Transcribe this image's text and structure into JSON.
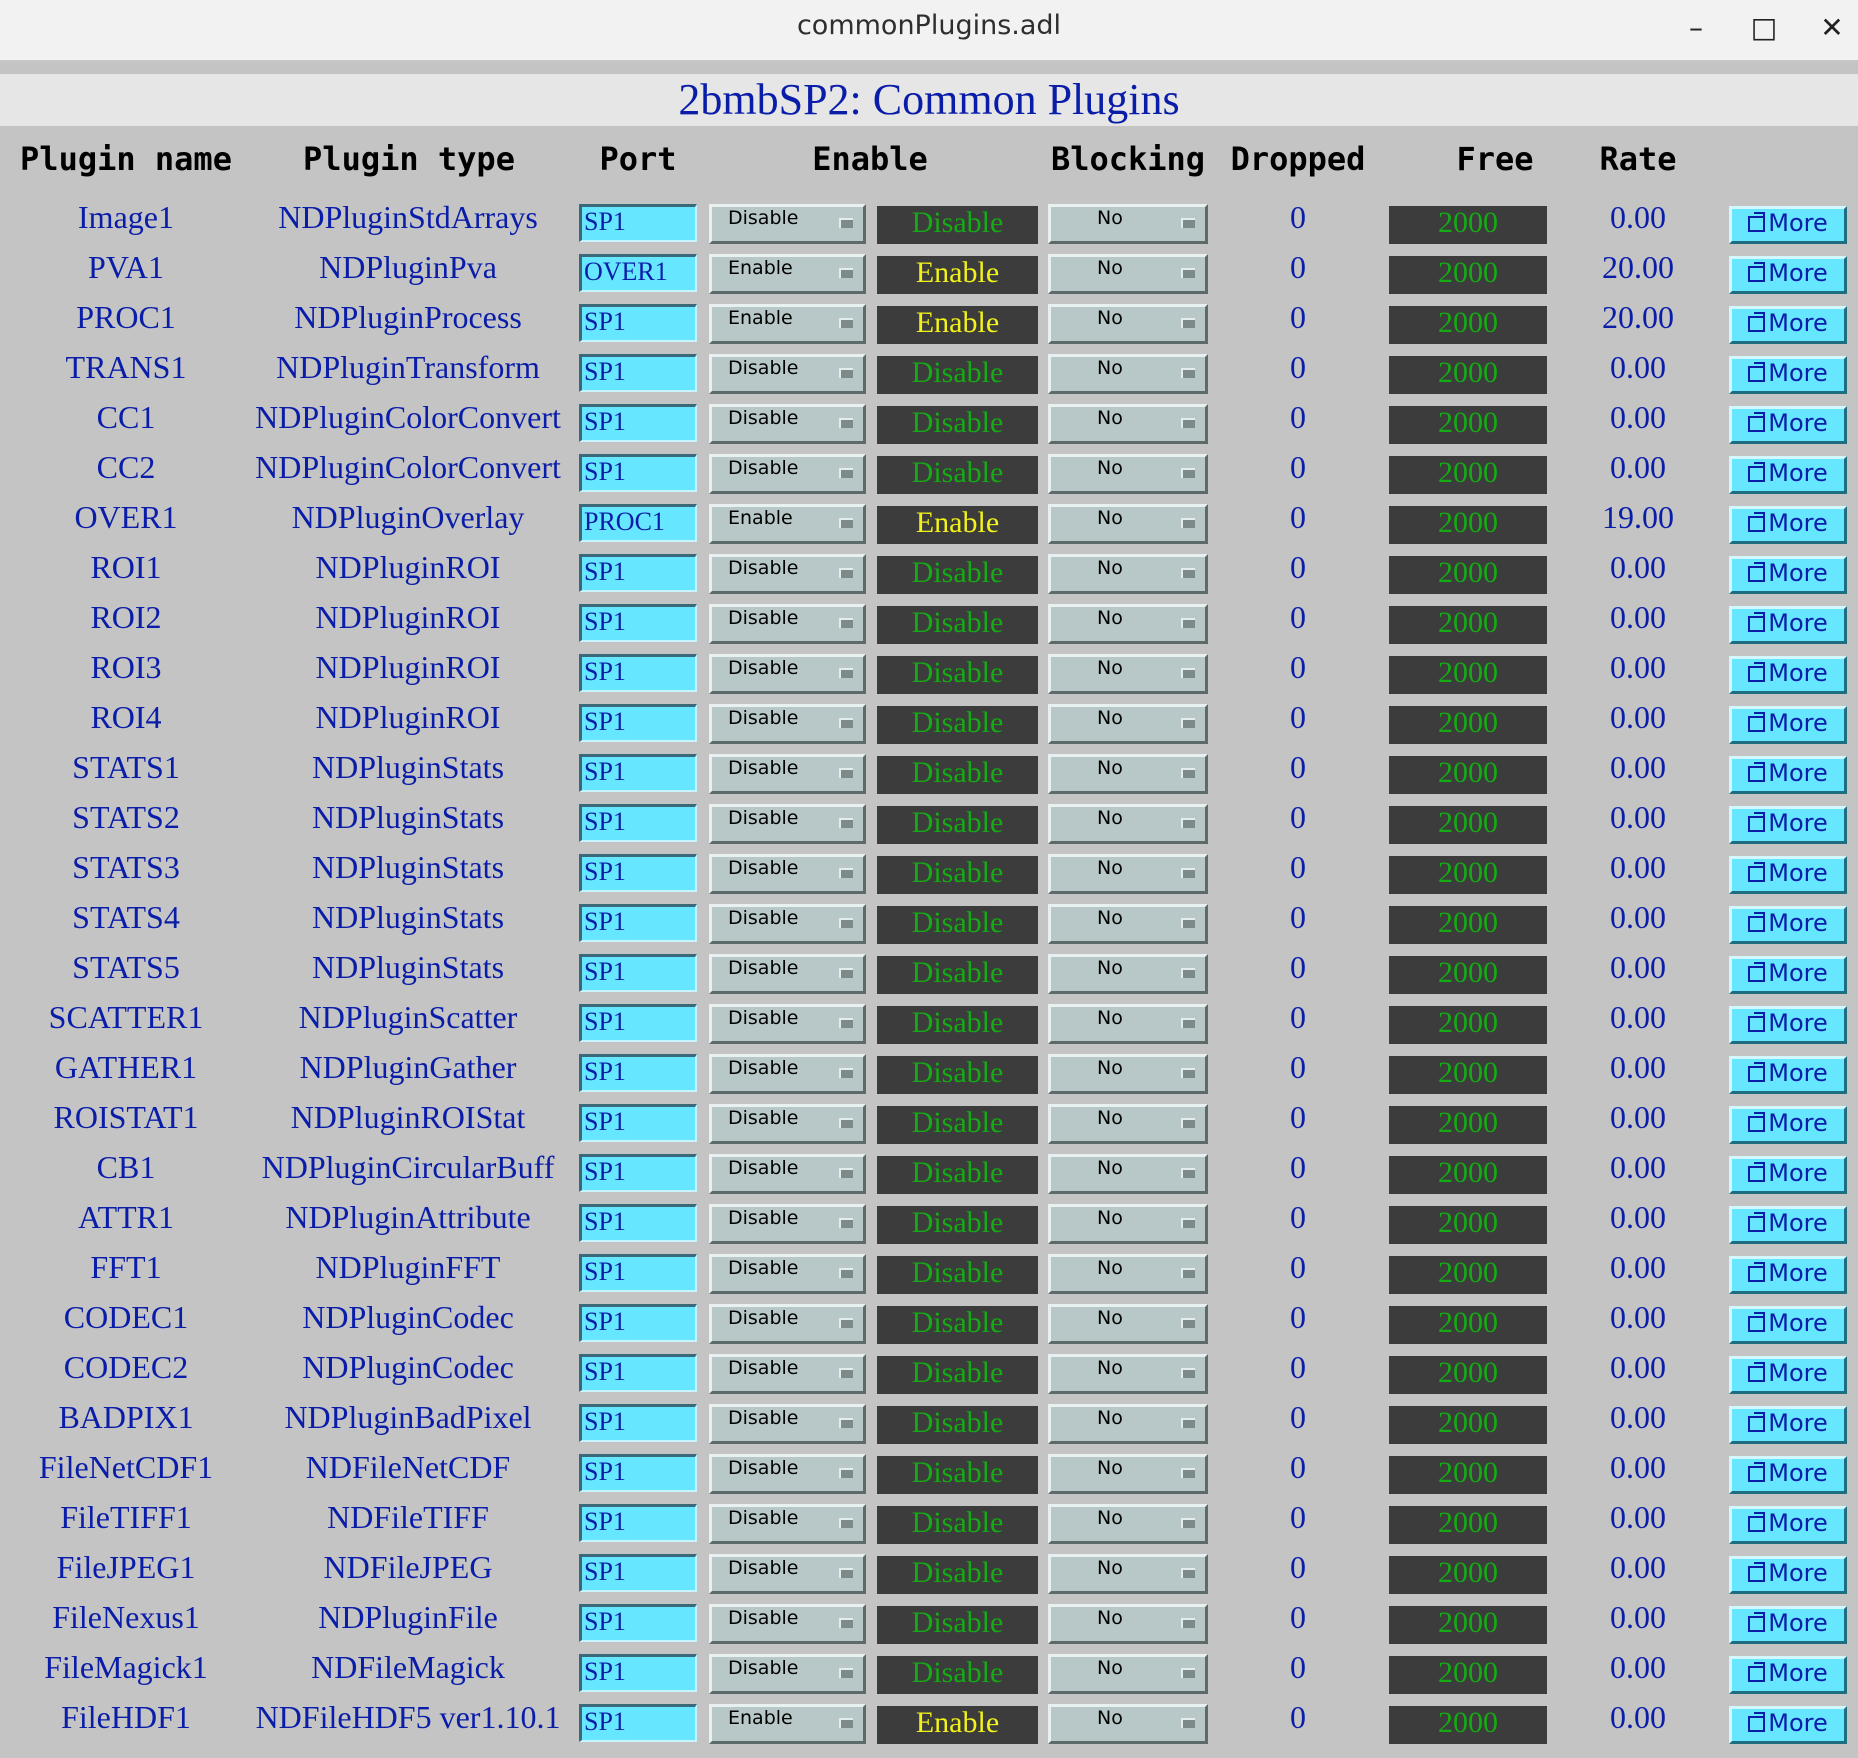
{
  "window": {
    "title": "commonPlugins.adl",
    "minimize": "–",
    "maximize": "□",
    "close": "✕"
  },
  "page_title": "2bmbSP2: Common Plugins",
  "columns": {
    "name": "Plugin name",
    "type": "Plugin type",
    "port": "Port",
    "enable": "Enable",
    "blocking": "Blocking",
    "dropped": "Dropped",
    "free": "Free",
    "rate": "Rate"
  },
  "colors": {
    "port_field": "#66e6ff",
    "status_enabled": "#f2f21a",
    "status_disabled": "#14ab14",
    "readback_bg": "#3c3c3c",
    "label_text": "#0a1da8"
  },
  "rows": [
    {
      "name": "Image1",
      "type": "NDPluginStdArrays",
      "port": "SP1",
      "enable_menu": "Disable",
      "status": "Disable",
      "blocking": "No",
      "dropped": "0",
      "free": "2000",
      "rate": "0.00",
      "more": "More"
    },
    {
      "name": "PVA1",
      "type": "NDPluginPva",
      "port": "OVER1",
      "enable_menu": "Enable",
      "status": "Enable",
      "blocking": "No",
      "dropped": "0",
      "free": "2000",
      "rate": "20.00",
      "more": "More"
    },
    {
      "name": "PROC1",
      "type": "NDPluginProcess",
      "port": "SP1",
      "enable_menu": "Enable",
      "status": "Enable",
      "blocking": "No",
      "dropped": "0",
      "free": "2000",
      "rate": "20.00",
      "more": "More"
    },
    {
      "name": "TRANS1",
      "type": "NDPluginTransform",
      "port": "SP1",
      "enable_menu": "Disable",
      "status": "Disable",
      "blocking": "No",
      "dropped": "0",
      "free": "2000",
      "rate": "0.00",
      "more": "More"
    },
    {
      "name": "CC1",
      "type": "NDPluginColorConvert",
      "port": "SP1",
      "enable_menu": "Disable",
      "status": "Disable",
      "blocking": "No",
      "dropped": "0",
      "free": "2000",
      "rate": "0.00",
      "more": "More"
    },
    {
      "name": "CC2",
      "type": "NDPluginColorConvert",
      "port": "SP1",
      "enable_menu": "Disable",
      "status": "Disable",
      "blocking": "No",
      "dropped": "0",
      "free": "2000",
      "rate": "0.00",
      "more": "More"
    },
    {
      "name": "OVER1",
      "type": "NDPluginOverlay",
      "port": "PROC1",
      "enable_menu": "Enable",
      "status": "Enable",
      "blocking": "No",
      "dropped": "0",
      "free": "2000",
      "rate": "19.00",
      "more": "More"
    },
    {
      "name": "ROI1",
      "type": "NDPluginROI",
      "port": "SP1",
      "enable_menu": "Disable",
      "status": "Disable",
      "blocking": "No",
      "dropped": "0",
      "free": "2000",
      "rate": "0.00",
      "more": "More"
    },
    {
      "name": "ROI2",
      "type": "NDPluginROI",
      "port": "SP1",
      "enable_menu": "Disable",
      "status": "Disable",
      "blocking": "No",
      "dropped": "0",
      "free": "2000",
      "rate": "0.00",
      "more": "More"
    },
    {
      "name": "ROI3",
      "type": "NDPluginROI",
      "port": "SP1",
      "enable_menu": "Disable",
      "status": "Disable",
      "blocking": "No",
      "dropped": "0",
      "free": "2000",
      "rate": "0.00",
      "more": "More"
    },
    {
      "name": "ROI4",
      "type": "NDPluginROI",
      "port": "SP1",
      "enable_menu": "Disable",
      "status": "Disable",
      "blocking": "No",
      "dropped": "0",
      "free": "2000",
      "rate": "0.00",
      "more": "More"
    },
    {
      "name": "STATS1",
      "type": "NDPluginStats",
      "port": "SP1",
      "enable_menu": "Disable",
      "status": "Disable",
      "blocking": "No",
      "dropped": "0",
      "free": "2000",
      "rate": "0.00",
      "more": "More"
    },
    {
      "name": "STATS2",
      "type": "NDPluginStats",
      "port": "SP1",
      "enable_menu": "Disable",
      "status": "Disable",
      "blocking": "No",
      "dropped": "0",
      "free": "2000",
      "rate": "0.00",
      "more": "More"
    },
    {
      "name": "STATS3",
      "type": "NDPluginStats",
      "port": "SP1",
      "enable_menu": "Disable",
      "status": "Disable",
      "blocking": "No",
      "dropped": "0",
      "free": "2000",
      "rate": "0.00",
      "more": "More"
    },
    {
      "name": "STATS4",
      "type": "NDPluginStats",
      "port": "SP1",
      "enable_menu": "Disable",
      "status": "Disable",
      "blocking": "No",
      "dropped": "0",
      "free": "2000",
      "rate": "0.00",
      "more": "More"
    },
    {
      "name": "STATS5",
      "type": "NDPluginStats",
      "port": "SP1",
      "enable_menu": "Disable",
      "status": "Disable",
      "blocking": "No",
      "dropped": "0",
      "free": "2000",
      "rate": "0.00",
      "more": "More"
    },
    {
      "name": "SCATTER1",
      "type": "NDPluginScatter",
      "port": "SP1",
      "enable_menu": "Disable",
      "status": "Disable",
      "blocking": "No",
      "dropped": "0",
      "free": "2000",
      "rate": "0.00",
      "more": "More"
    },
    {
      "name": "GATHER1",
      "type": "NDPluginGather",
      "port": "SP1",
      "enable_menu": "Disable",
      "status": "Disable",
      "blocking": "No",
      "dropped": "0",
      "free": "2000",
      "rate": "0.00",
      "more": "More"
    },
    {
      "name": "ROISTAT1",
      "type": "NDPluginROIStat",
      "port": "SP1",
      "enable_menu": "Disable",
      "status": "Disable",
      "blocking": "No",
      "dropped": "0",
      "free": "2000",
      "rate": "0.00",
      "more": "More"
    },
    {
      "name": "CB1",
      "type": "NDPluginCircularBuff",
      "port": "SP1",
      "enable_menu": "Disable",
      "status": "Disable",
      "blocking": "No",
      "dropped": "0",
      "free": "2000",
      "rate": "0.00",
      "more": "More"
    },
    {
      "name": "ATTR1",
      "type": "NDPluginAttribute",
      "port": "SP1",
      "enable_menu": "Disable",
      "status": "Disable",
      "blocking": "No",
      "dropped": "0",
      "free": "2000",
      "rate": "0.00",
      "more": "More"
    },
    {
      "name": "FFT1",
      "type": "NDPluginFFT",
      "port": "SP1",
      "enable_menu": "Disable",
      "status": "Disable",
      "blocking": "No",
      "dropped": "0",
      "free": "2000",
      "rate": "0.00",
      "more": "More"
    },
    {
      "name": "CODEC1",
      "type": "NDPluginCodec",
      "port": "SP1",
      "enable_menu": "Disable",
      "status": "Disable",
      "blocking": "No",
      "dropped": "0",
      "free": "2000",
      "rate": "0.00",
      "more": "More"
    },
    {
      "name": "CODEC2",
      "type": "NDPluginCodec",
      "port": "SP1",
      "enable_menu": "Disable",
      "status": "Disable",
      "blocking": "No",
      "dropped": "0",
      "free": "2000",
      "rate": "0.00",
      "more": "More"
    },
    {
      "name": "BADPIX1",
      "type": "NDPluginBadPixel",
      "port": "SP1",
      "enable_menu": "Disable",
      "status": "Disable",
      "blocking": "No",
      "dropped": "0",
      "free": "2000",
      "rate": "0.00",
      "more": "More"
    },
    {
      "name": "FileNetCDF1",
      "type": "NDFileNetCDF",
      "port": "SP1",
      "enable_menu": "Disable",
      "status": "Disable",
      "blocking": "No",
      "dropped": "0",
      "free": "2000",
      "rate": "0.00",
      "more": "More"
    },
    {
      "name": "FileTIFF1",
      "type": "NDFileTIFF",
      "port": "SP1",
      "enable_menu": "Disable",
      "status": "Disable",
      "blocking": "No",
      "dropped": "0",
      "free": "2000",
      "rate": "0.00",
      "more": "More"
    },
    {
      "name": "FileJPEG1",
      "type": "NDFileJPEG",
      "port": "SP1",
      "enable_menu": "Disable",
      "status": "Disable",
      "blocking": "No",
      "dropped": "0",
      "free": "2000",
      "rate": "0.00",
      "more": "More"
    },
    {
      "name": "FileNexus1",
      "type": "NDPluginFile",
      "port": "SP1",
      "enable_menu": "Disable",
      "status": "Disable",
      "blocking": "No",
      "dropped": "0",
      "free": "2000",
      "rate": "0.00",
      "more": "More"
    },
    {
      "name": "FileMagick1",
      "type": "NDFileMagick",
      "port": "SP1",
      "enable_menu": "Disable",
      "status": "Disable",
      "blocking": "No",
      "dropped": "0",
      "free": "2000",
      "rate": "0.00",
      "more": "More"
    },
    {
      "name": "FileHDF1",
      "type": "NDFileHDF5 ver1.10.1",
      "port": "SP1",
      "enable_menu": "Enable",
      "status": "Enable",
      "blocking": "No",
      "dropped": "0",
      "free": "2000",
      "rate": "0.00",
      "more": "More"
    }
  ]
}
